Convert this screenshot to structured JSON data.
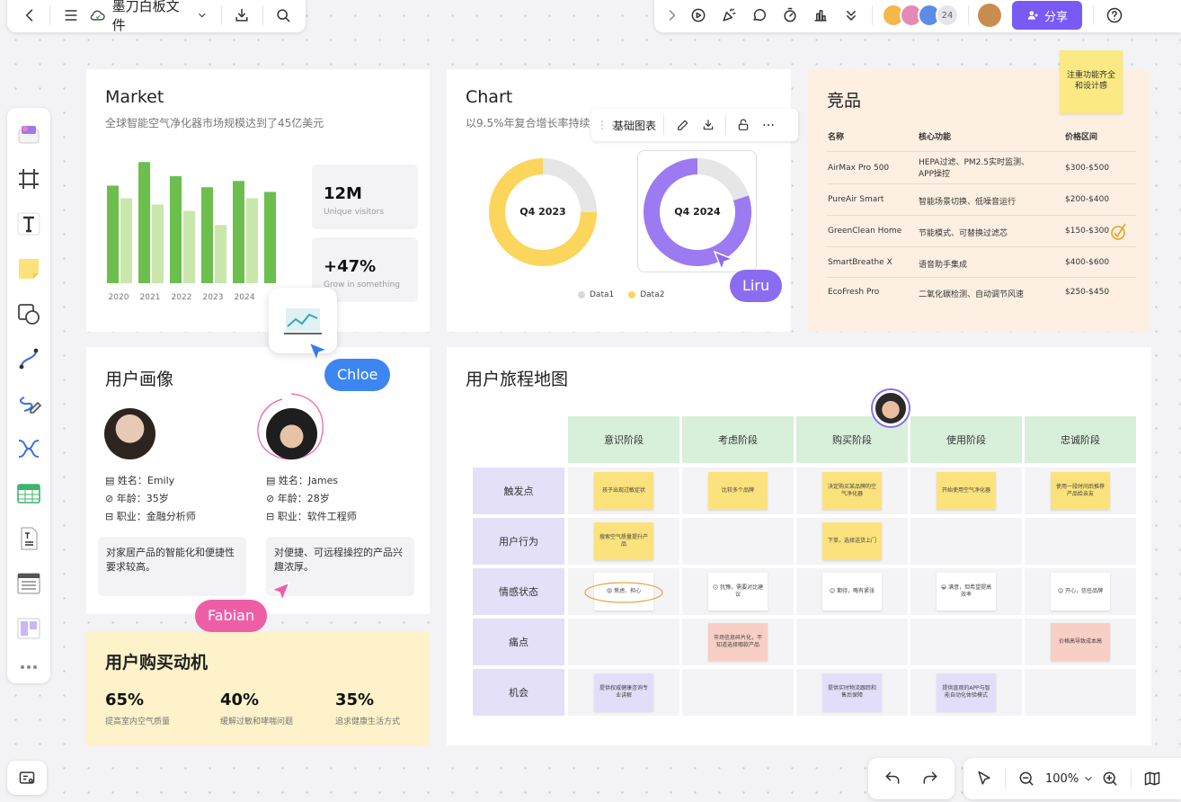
{
  "top_bar": {
    "file_name": "墨刀白板文件",
    "avatar_count": "24",
    "share_label": "分享"
  },
  "market": {
    "title": "Market",
    "subtitle": "全球智能空气净化器市场规模达到了45亿美元",
    "stats": [
      {
        "value": "12M",
        "label": "Unique visitors"
      },
      {
        "value": "+47%",
        "label": "Grow in something"
      }
    ]
  },
  "chart_data": [
    {
      "type": "bar",
      "categories": [
        "2020",
        "2021",
        "2022",
        "2023",
        "2024"
      ],
      "series": [
        {
          "values": [
            62,
            77,
            68,
            61,
            65
          ],
          "color": "#6cbf4c"
        },
        {
          "values": [
            54,
            50,
            46,
            37,
            54
          ],
          "color": "#c9e7ab"
        }
      ],
      "extra_bar": {
        "value": 58,
        "color": "#6cbf4c"
      }
    },
    {
      "type": "pie",
      "title": "Q4 2023",
      "series": [
        {
          "name": "Data1",
          "values": [
            25
          ],
          "color": "#e6e6e6"
        },
        {
          "name": "Data2",
          "values": [
            75
          ],
          "color": "#fbd55c"
        }
      ]
    },
    {
      "type": "pie",
      "title": "Q4 2024",
      "series": [
        {
          "name": "Data1",
          "values": [
            20
          ],
          "color": "#e6e6e6"
        },
        {
          "name": "Data2",
          "values": [
            80
          ],
          "color": "#9b7af2"
        }
      ]
    }
  ],
  "chart_card": {
    "title": "Chart",
    "subtitle": "以9.5%年复合增长率持续",
    "toolbar_label": "基础图表",
    "legend": [
      "Data1",
      "Data2"
    ]
  },
  "competitors": {
    "title": "竞品",
    "sticky": "注重功能齐全和设计感",
    "headers": [
      "名称",
      "核心功能",
      "价格区间"
    ],
    "rows": [
      {
        "name": "AirMax Pro 500",
        "feature": "HEPA过滤、PM2.5实时监测、APP操控",
        "price": "$300-$500"
      },
      {
        "name": "PureAir Smart",
        "feature": "智能场景切换、低噪音运行",
        "price": "$200-$400"
      },
      {
        "name": "GreenClean Home",
        "feature": "节能模式、可替换过滤芯",
        "price": "$150-$300"
      },
      {
        "name": "SmartBreathe X",
        "feature": "语音助手集成",
        "price": "$400-$600"
      },
      {
        "name": "EcoFresh Pro",
        "feature": "二氧化碳检测、自动调节风速",
        "price": "$250-$450"
      }
    ]
  },
  "persona": {
    "title": "用户画像",
    "users": [
      {
        "name": "姓名：Emily",
        "age": "年龄：35岁",
        "job": "职业：金融分析师",
        "desc": "对家居产品的智能化和便捷性要求较高。"
      },
      {
        "name": "姓名：James",
        "age": "年龄：28岁",
        "job": "职业：软件工程师",
        "desc": "对便捷、可远程操控的产品兴趣浓厚。"
      }
    ]
  },
  "motivation": {
    "title": "用户购买动机",
    "items": [
      {
        "value": "65%",
        "label": "提高室内空气质量"
      },
      {
        "value": "40%",
        "label": "缓解过敏和哮喘问题"
      },
      {
        "value": "35%",
        "label": "追求健康生活方式"
      }
    ]
  },
  "journey": {
    "title": "用户旅程地图",
    "stages": [
      "意识阶段",
      "考虑阶段",
      "购买阶段",
      "使用阶段",
      "忠诚阶段"
    ],
    "rows": [
      "触发点",
      "用户行为",
      "情感状态",
      "痛点",
      "机会"
    ],
    "notes": [
      [
        "孩子出现过敏症状",
        "比较多个品牌",
        "决定购买某品牌的空气净化器",
        "开始使用空气净化器",
        "使用一段时间后推荐产品给亲友"
      ],
      [
        "搜索空气质量提升产品",
        "",
        "下单，选择送货上门",
        "",
        ""
      ],
      [
        "😟 焦虑、担心",
        "😐 犹豫，需要对比建议",
        "😊 期待，略有紧张",
        "😀 满意，但希望提高效率",
        "😊 开心，信任品牌"
      ],
      [
        "",
        "市场信息碎片化，不知道选择哪款产品",
        "",
        "",
        "价格高导致成本高"
      ],
      [
        "提供权威健康咨询专业讲解",
        "",
        "提供实时物流跟踪和售后保障",
        "提供直观的APP与智能自动化体验模式",
        ""
      ]
    ]
  },
  "cursors": {
    "liru": "Liru",
    "chloe": "Chloe",
    "fabian": "Fabian"
  },
  "zoom": "100%"
}
